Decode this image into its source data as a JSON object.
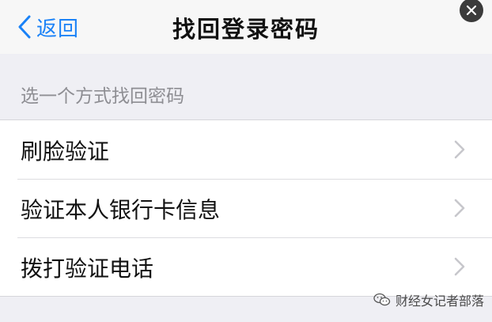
{
  "nav": {
    "back_label": "返回",
    "title": "找回登录密码",
    "close_icon": "close-icon"
  },
  "section": {
    "header": "选一个方式找回密码"
  },
  "options": [
    {
      "label": "刷脸验证",
      "icon": "chevron-right-icon"
    },
    {
      "label": "验证本人银行卡信息",
      "icon": "chevron-right-icon"
    },
    {
      "label": "拨打验证电话",
      "icon": "chevron-right-icon"
    }
  ],
  "watermark": {
    "text": "财经女记者部落",
    "icon": "wechat-icon"
  },
  "colors": {
    "accent": "#1a82f7",
    "background": "#efeff4",
    "chevron": "#c7c7cc"
  }
}
